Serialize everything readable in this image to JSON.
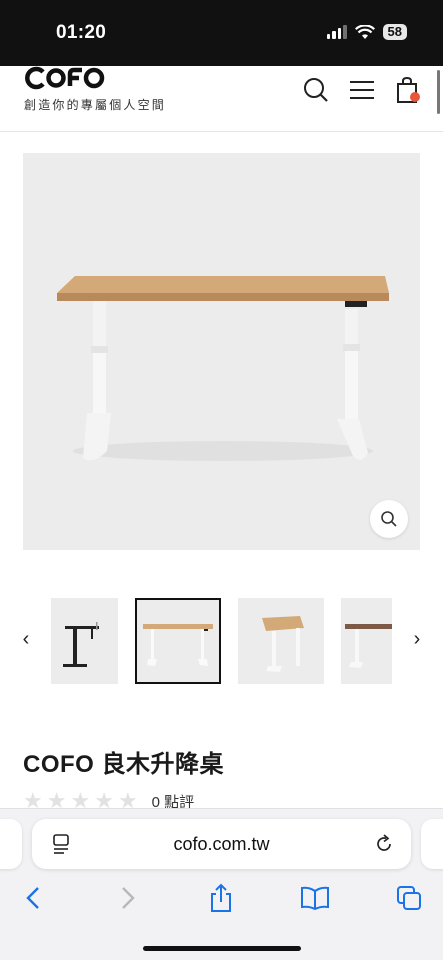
{
  "status_bar": {
    "time": "01:20",
    "battery": "58"
  },
  "header": {
    "logo_text": "COFO",
    "tagline": "創造你的專屬個人空間"
  },
  "product": {
    "title": "COFO 良木升降桌",
    "rating_count": "0 點評"
  },
  "gallery": {
    "prev_label": "‹",
    "next_label": "›"
  },
  "browser": {
    "url": "cofo.com.tw"
  },
  "colors": {
    "accent_dot": "#e8553a",
    "wood": "#c9a070",
    "frame_white": "#f4f4f4"
  }
}
